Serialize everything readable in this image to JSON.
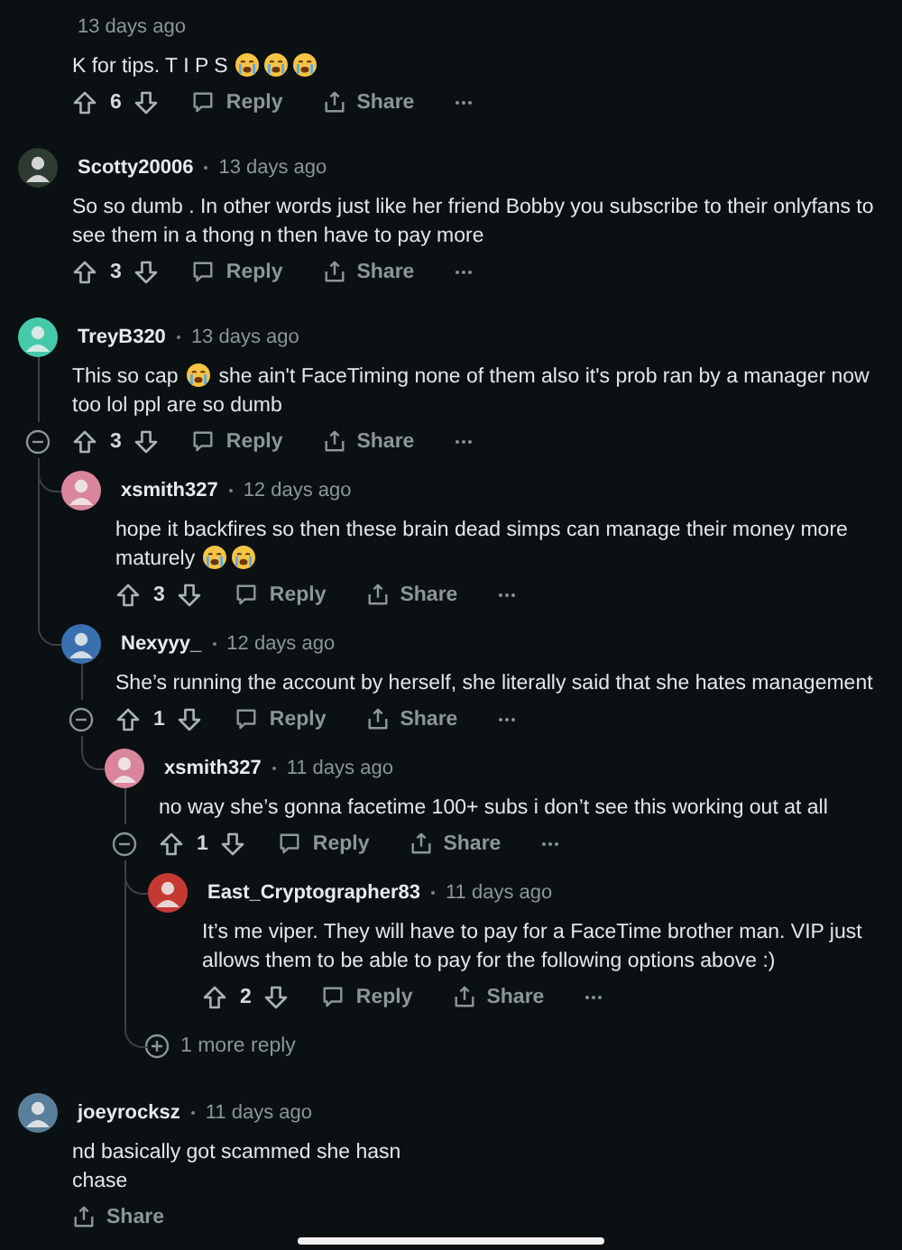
{
  "comments": [
    {
      "kind": "comment",
      "time": "13 days ago",
      "body": [
        {
          "kind": "text",
          "text": "K for tips. T I P S "
        },
        {
          "kind": "emoji"
        },
        {
          "kind": "emoji"
        },
        {
          "kind": "emoji"
        }
      ],
      "votes": "6",
      "reply": "Reply",
      "share": "Share"
    },
    {
      "kind": "comment",
      "username": "Scotty20006",
      "color": "#2f3a33",
      "time": "13 days ago",
      "body": [
        {
          "kind": "text",
          "text": "So so dumb . In other words just like her friend Bobby you subscribe to their onlyfans to see them in a thong n then have to pay more"
        }
      ],
      "votes": "3",
      "reply": "Reply",
      "share": "Share"
    },
    {
      "kind": "comment",
      "username": "TreyB320",
      "color": "#46c9a8",
      "time": "13 days ago",
      "body": [
        {
          "kind": "text",
          "text": "This so cap "
        },
        {
          "kind": "emoji"
        },
        {
          "kind": "text",
          "text": " she ain't FaceTiming none of them also it's prob ran by a manager now too lol ppl are so dumb"
        }
      ],
      "votes": "3",
      "reply": "Reply",
      "share": "Share",
      "expanded": true,
      "children": [
        {
          "kind": "comment",
          "username": "xsmith327",
          "color": "#d9869c",
          "time": "12 days ago",
          "body": [
            {
              "kind": "text",
              "text": "hope it backfires so then these brain dead simps can manage their money more maturely "
            },
            {
              "kind": "emoji"
            },
            {
              "kind": "emoji"
            }
          ],
          "votes": "3",
          "reply": "Reply",
          "share": "Share"
        },
        {
          "kind": "comment",
          "username": "Nexyyy_",
          "color": "#3a6fb0",
          "time": "12 days ago",
          "body": [
            {
              "kind": "text",
              "text": "She’s running the account by herself, she literally said that she hates management"
            }
          ],
          "votes": "1",
          "reply": "Reply",
          "share": "Share",
          "expanded": true,
          "children": [
            {
              "kind": "comment",
              "username": "xsmith327",
              "color": "#d9869c",
              "time": "11 days ago",
              "body": [
                {
                  "kind": "text",
                  "text": "no way she’s gonna facetime 100+ subs i don’t see this working out at all"
                }
              ],
              "votes": "1",
              "reply": "Reply",
              "share": "Share",
              "expanded": true,
              "children": [
                {
                  "kind": "comment",
                  "username": "East_Cryptographer83",
                  "color": "#c43a33",
                  "time": "11 days ago",
                  "body": [
                    {
                      "kind": "text",
                      "text": "It’s me viper. They will have to pay for a FaceTime brother man. VIP just allows them to be able to pay for the following options above :)"
                    }
                  ],
                  "votes": "2",
                  "reply": "Reply",
                  "share": "Share"
                },
                {
                  "kind": "more",
                  "text": "1 more reply"
                }
              ]
            }
          ]
        }
      ]
    },
    {
      "kind": "comment",
      "username": "joeyrocksz",
      "color": "#5a7f9a",
      "time": "11 days ago",
      "body": [
        {
          "kind": "text",
          "text": "nd basically got scammed she hasn"
        },
        {
          "kind": "break"
        },
        {
          "kind": "text",
          "text": "chase"
        }
      ],
      "share": "Share"
    }
  ]
}
